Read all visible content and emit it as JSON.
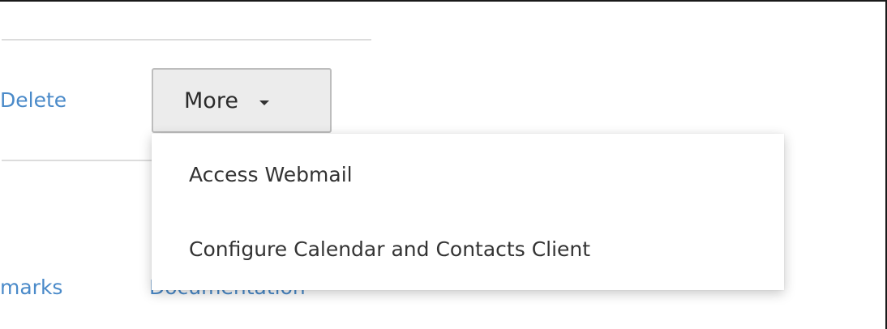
{
  "actions": {
    "delete_partial": "Delete",
    "more_label": "More"
  },
  "more_menu": {
    "items": [
      {
        "label": "Access Webmail"
      },
      {
        "label": "Configure Calendar and Contacts Client"
      }
    ]
  },
  "footer_links": {
    "bookmarks_partial": "marks",
    "documentation": "Documentation"
  },
  "colors": {
    "link": "#4a8ac9",
    "button_bg": "#ececec",
    "menu_text": "#333333"
  }
}
